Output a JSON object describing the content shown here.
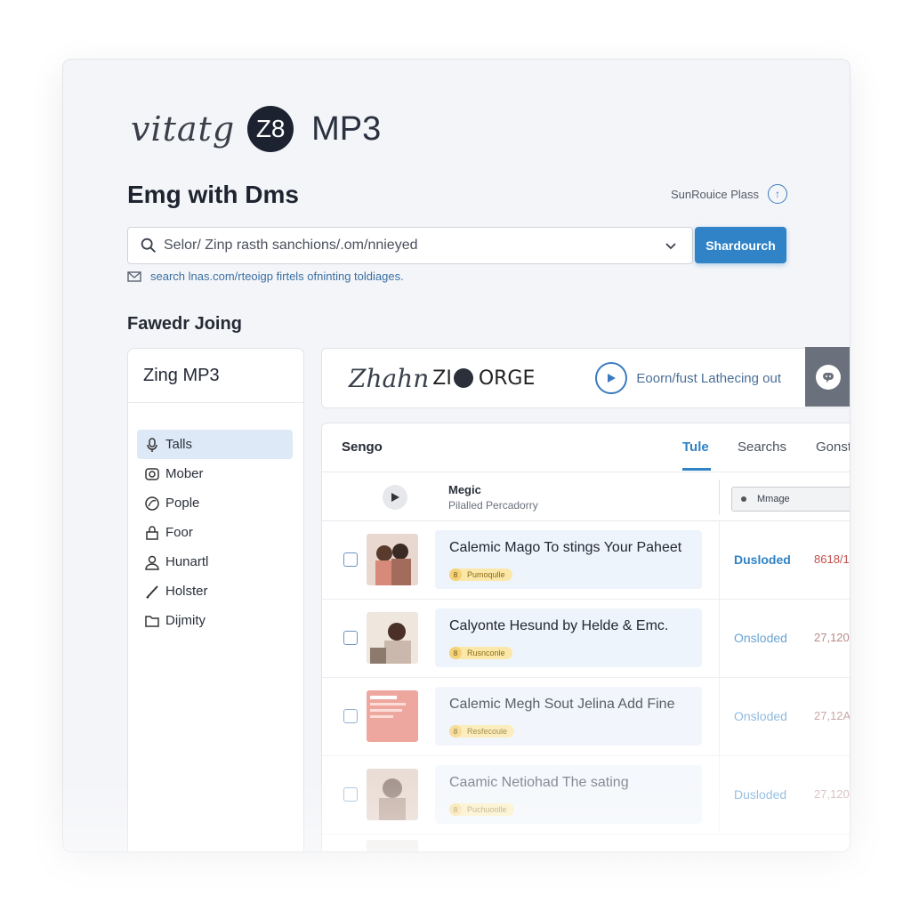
{
  "logo": {
    "script_text": "vitatg",
    "circle_text": "Z8",
    "product": "MP3"
  },
  "heading": "Emg with Dms",
  "resource_link": "SunRouice Plass",
  "search": {
    "placeholder": "Selor/ Zinp rasth sanchions/.om/nnieyed",
    "button_label": "Shardourch",
    "hint": "search lnas.com/rteoigp firtels ofninting toldiages."
  },
  "section_title": "Fawedr Joing",
  "sidebar": {
    "title": "Zing MP3",
    "items": [
      {
        "label": "Talls",
        "icon": "mic-icon",
        "active": true
      },
      {
        "label": "Mober",
        "icon": "camera-icon"
      },
      {
        "label": "Pople",
        "icon": "disc-icon"
      },
      {
        "label": "Foor",
        "icon": "lock-icon"
      },
      {
        "label": "Hunartl",
        "icon": "user-icon"
      },
      {
        "label": "Holster",
        "icon": "pen-icon"
      },
      {
        "label": "Dijmity",
        "icon": "folder-icon"
      }
    ]
  },
  "banner": {
    "brand_script": "Zhahn",
    "brand_text": "ZI",
    "brand_text2": "ORGE",
    "cta": "Eoorn/fust Lathecing out"
  },
  "tabs": {
    "left_label": "Sengo",
    "items": [
      {
        "label": "Tule",
        "active": true
      },
      {
        "label": "Searchs"
      },
      {
        "label": "Gonst"
      }
    ]
  },
  "table_header": {
    "title": "Megic",
    "subtitle": "Pilalled Percadorry",
    "filter_value": "Mmage"
  },
  "rows": [
    {
      "title": "Calemic Mago To stings Your Paheet",
      "tag": "Pumoqulle",
      "status": "Dusloded",
      "size": "8618/1"
    },
    {
      "title": "Calyonte Hesund by Helde & Emc.",
      "tag": "Rusnconle",
      "status": "Onsloded",
      "size": "27,120"
    },
    {
      "title": "Calemic Megh Sout Jelina Add Fine",
      "tag": "Resfecoule",
      "status": "Onsloded",
      "size": "27,12A"
    },
    {
      "title": "Caamic Netiohad The sating",
      "tag": "Puchuoolle",
      "status": "Dusloded",
      "size": "27,120"
    }
  ],
  "colors": {
    "accent": "#2f83c6",
    "sidebar_active": "#dde9f7",
    "row_highlight": "#eef4fb",
    "tag": "#fbe8a9"
  }
}
